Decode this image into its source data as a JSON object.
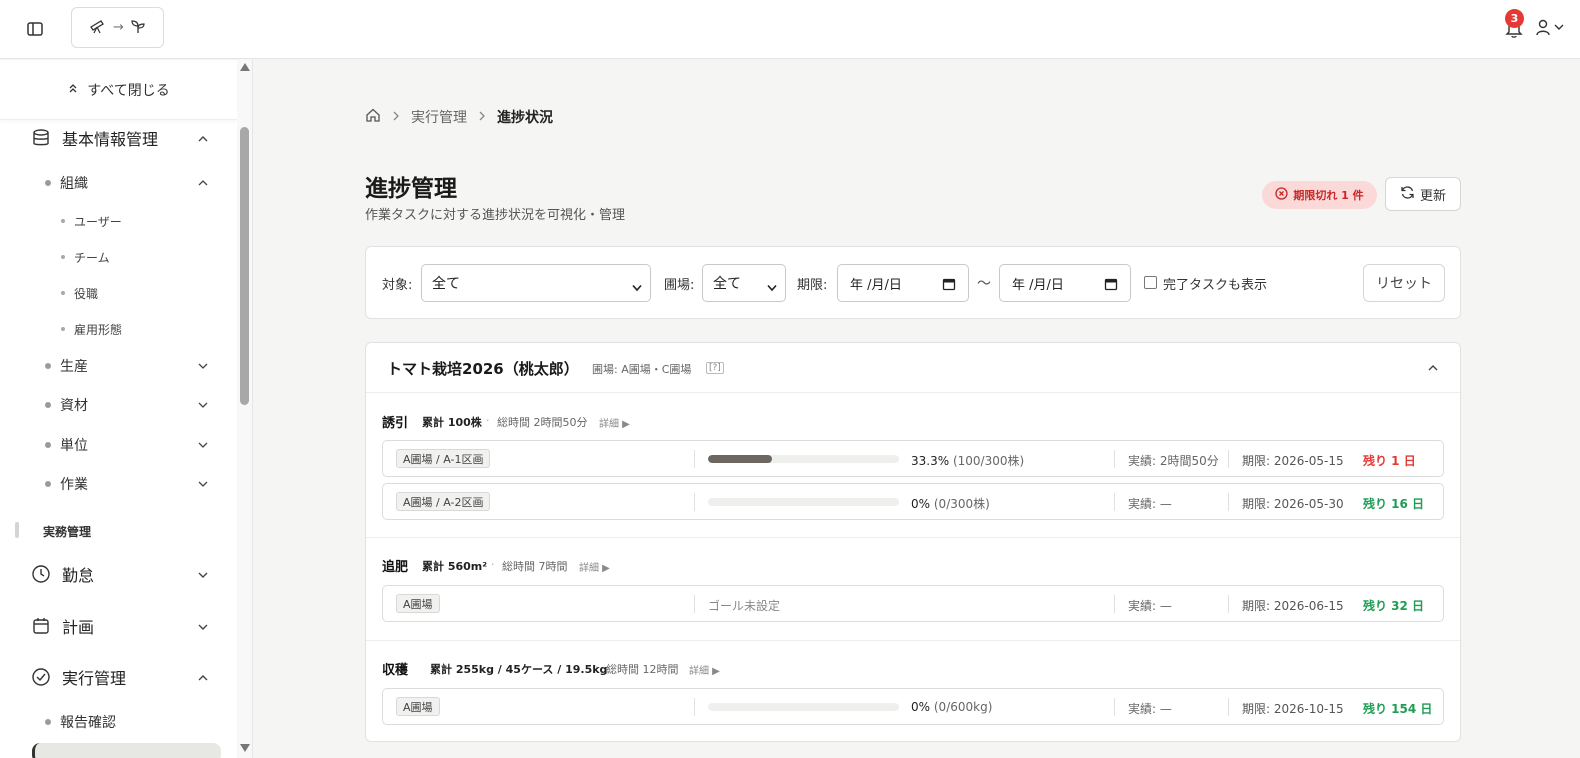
{
  "header": {
    "logo_arrow": "→",
    "notification_count": "3"
  },
  "sidebar": {
    "collapse_all": "すべて閉じる",
    "basic_info": "基本情報管理",
    "org": "組織",
    "org_items": [
      "ユーザー",
      "チーム",
      "役職",
      "雇用形態"
    ],
    "production": "生産",
    "materials": "資材",
    "units": "単位",
    "work": "作業",
    "section_business": "実務管理",
    "attendance": "勤怠",
    "plan": "計画",
    "execution": "実行管理",
    "report": "報告確認"
  },
  "breadcrumb": {
    "parent": "実行管理",
    "current": "進捗状況"
  },
  "page": {
    "title": "進捗管理",
    "subtitle": "作業タスクに対する進捗状況を可視化・管理",
    "overdue_badge": "期限切れ 1 件",
    "refresh_label": "更新"
  },
  "filters": {
    "target_label": "対象:",
    "target_value": "全て",
    "field_label": "圃場:",
    "field_value": "全て",
    "deadline_label": "期限:",
    "date_from": "年 /月/日",
    "tilde": "～",
    "date_to": "年 /月/日",
    "show_completed": "完了タスクも表示",
    "reset_label": "リセット"
  },
  "plan": {
    "title": "トマト栽培2026（桃太郎）",
    "fields": "圃場: A圃場・C圃場",
    "help": "[?]",
    "detail_label": "詳細 ▶",
    "tasks": [
      {
        "name": "誘引",
        "total": "累計 100株",
        "sep": "·",
        "time": "総時間 2時間50分",
        "rows": [
          {
            "location": "A圃場 / A-1区画",
            "progress": 33.3,
            "pct": "33.3%",
            "pct_sub": "(100/300株)",
            "actual": "実績: 2時間50分",
            "due": "期限: 2026-05-15",
            "remain": "残り 1 日",
            "remain_color": "#e53935"
          },
          {
            "location": "A圃場 / A-2区画",
            "progress": 0,
            "pct": "0%",
            "pct_sub": "(0/300株)",
            "actual": "実績: —",
            "due": "期限: 2026-05-30",
            "remain": "残り 16 日",
            "remain_color": "#1f9d55"
          }
        ]
      },
      {
        "name": "追肥",
        "total": "累計 560m²",
        "sep": "·",
        "time": "総時間 7時間",
        "rows": [
          {
            "location": "A圃場",
            "no_goal": "ゴール未設定",
            "actual": "実績: —",
            "due": "期限: 2026-06-15",
            "remain": "残り 32 日",
            "remain_color": "#1f9d55"
          }
        ]
      },
      {
        "name": "収穫",
        "total": "累計 255kg / 45ケース / 19.5kg",
        "sep": "·",
        "time": "総時間 12時間",
        "rows": [
          {
            "location": "A圃場",
            "progress": 0,
            "pct": "0%",
            "pct_sub": "(0/600kg)",
            "actual": "実績: —",
            "due": "期限: 2026-10-15",
            "remain": "残り 154 日",
            "remain_color": "#1f9d55"
          }
        ]
      }
    ]
  }
}
